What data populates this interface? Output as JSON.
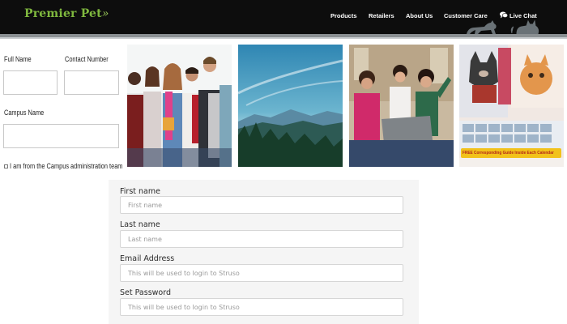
{
  "header": {
    "logo": "Premier Pet",
    "logo_tail": "»",
    "nav": [
      "Products",
      "Retailers",
      "About Us",
      "Customer Care",
      "Live Chat"
    ],
    "icons": [
      "chat-bubble-icon"
    ]
  },
  "left_form": {
    "full_name_label": "Full Name",
    "contact_label": "Contact Number",
    "campus_label": "Campus Name",
    "admin_checkbox_label": "I am from the Campus administration team"
  },
  "photos": {
    "calendar_banner": "FREE Corresponding Guide Inside Each Calendar"
  },
  "signup": {
    "fields": [
      {
        "label": "First name",
        "placeholder": "First name"
      },
      {
        "label": "Last name",
        "placeholder": "Last name"
      },
      {
        "label": "Email Address",
        "placeholder": "This will be used to login to Struso"
      },
      {
        "label": "Set Password",
        "placeholder": "This will be used to login to Struso"
      }
    ]
  },
  "colors": {
    "header_bg": "#0d0d0d",
    "logo_green": "#7fb83e",
    "banner_yellow": "#f2c21b"
  }
}
